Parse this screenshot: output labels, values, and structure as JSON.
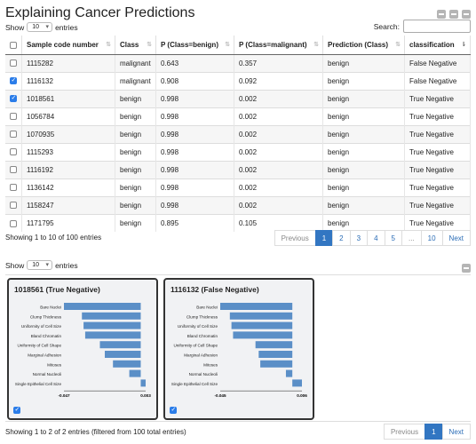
{
  "title": "Explaining Cancer Predictions",
  "top": {
    "show": "Show",
    "entries_value": "10",
    "entries": "entries",
    "search_label": "Search:"
  },
  "table": {
    "headers": [
      "Sample code number",
      "Class",
      "P (Class=benign)",
      "P (Class=malignant)",
      "Prediction (Class)",
      "classification"
    ],
    "rows": [
      {
        "checked": false,
        "cells": [
          "1115282",
          "malignant",
          "0.643",
          "0.357",
          "benign",
          "False Negative"
        ]
      },
      {
        "checked": true,
        "cells": [
          "1116132",
          "malignant",
          "0.908",
          "0.092",
          "benign",
          "False Negative"
        ]
      },
      {
        "checked": true,
        "cells": [
          "1018561",
          "benign",
          "0.998",
          "0.002",
          "benign",
          "True Negative"
        ]
      },
      {
        "checked": false,
        "cells": [
          "1056784",
          "benign",
          "0.998",
          "0.002",
          "benign",
          "True Negative"
        ]
      },
      {
        "checked": false,
        "cells": [
          "1070935",
          "benign",
          "0.998",
          "0.002",
          "benign",
          "True Negative"
        ]
      },
      {
        "checked": false,
        "cells": [
          "1115293",
          "benign",
          "0.998",
          "0.002",
          "benign",
          "True Negative"
        ]
      },
      {
        "checked": false,
        "cells": [
          "1116192",
          "benign",
          "0.998",
          "0.002",
          "benign",
          "True Negative"
        ]
      },
      {
        "checked": false,
        "cells": [
          "1136142",
          "benign",
          "0.998",
          "0.002",
          "benign",
          "True Negative"
        ]
      },
      {
        "checked": false,
        "cells": [
          "1158247",
          "benign",
          "0.998",
          "0.002",
          "benign",
          "True Negative"
        ]
      },
      {
        "checked": false,
        "cells": [
          "1171795",
          "benign",
          "0.895",
          "0.105",
          "benign",
          "True Negative"
        ]
      }
    ],
    "info": "Showing 1 to 10 of 100 entries",
    "pager": [
      "Previous",
      "1",
      "2",
      "3",
      "4",
      "5",
      "...",
      "10",
      "Next"
    ]
  },
  "bottom": {
    "show": "Show",
    "entries_value": "10",
    "entries": "entries",
    "info": "Showing 1 to 2 of 2 entries (filtered from 100 total entries)",
    "pager": [
      "Previous",
      "1",
      "Next"
    ]
  },
  "chart_data": [
    {
      "type": "bar",
      "title": "1018561 (True Negative)",
      "categories": [
        "Bare Nuclei",
        "Clump Thickness",
        "Uniformity of Cell Size",
        "Bland Chromatin",
        "Uniformity of Cell Shape",
        "Marginal Adhesion",
        "Mitoses",
        "Normal Nucleoli",
        "Single Epithelial Cell Size"
      ],
      "values": [
        -0.047,
        -0.036,
        -0.035,
        -0.034,
        -0.025,
        -0.022,
        -0.017,
        -0.007,
        0.003
      ],
      "xlim": [
        -0.047,
        0.003
      ],
      "xtick_labels": [
        "-0.047",
        "0.003"
      ],
      "color": "#5b8fc7"
    },
    {
      "type": "bar",
      "title": "1116132 (False Negative)",
      "categories": [
        "Bare Nuclei",
        "Clump Thickness",
        "Uniformity of Cell Size",
        "Bland Chromatin",
        "Uniformity of Cell Shape",
        "Marginal Adhesion",
        "Mitoses",
        "Normal Nucleoli",
        "Single Epithelial Cell Size"
      ],
      "values": [
        -0.045,
        -0.039,
        -0.038,
        -0.037,
        -0.023,
        -0.021,
        -0.02,
        -0.004,
        0.006
      ],
      "xlim": [
        -0.045,
        0.006
      ],
      "xtick_labels": [
        "-0.045",
        "0.006"
      ],
      "color": "#5b8fc7"
    }
  ]
}
